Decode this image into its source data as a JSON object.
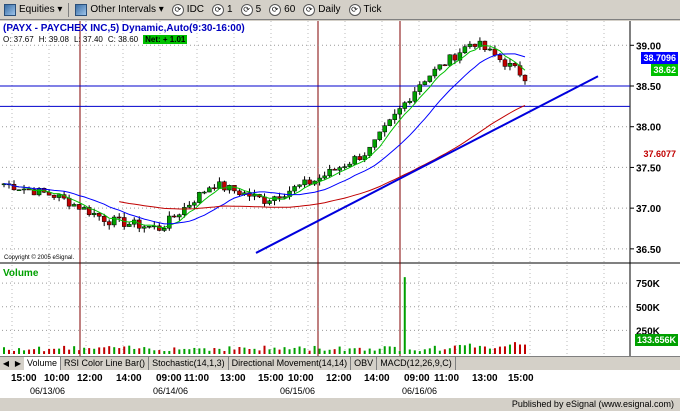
{
  "toolbar": {
    "equities": "Equities",
    "other_intervals": "Other Intervals",
    "idc": "IDC",
    "i1": "1",
    "i5": "5",
    "i60": "60",
    "daily": "Daily",
    "tick": "Tick"
  },
  "header": {
    "title": "(PAYX - PAYCHEX INC,5) Dynamic,Auto(9:30-16:00)",
    "open": "O: 37.67",
    "high": "H: 39.08",
    "low": "L: 37.40",
    "close": "C: 38.60",
    "net": "Net: + 1.01",
    "copyright": "Copyright © 2005 eSignal.",
    "volume_label": "Volume"
  },
  "axis": {
    "prices": [
      "39.00",
      "38.50",
      "38.00",
      "37.50",
      "37.00",
      "36.50"
    ],
    "volume": [
      "750K",
      "500K",
      "250K"
    ],
    "tag_last": "38.7096",
    "tag_close": "38.62",
    "tag_ma": "37.6077",
    "tag_vol": "133.656K"
  },
  "colors": {
    "candle_up": "#00a000",
    "candle_down": "#c00000",
    "ma_fast": "#00c000",
    "ma_mid": "#0000ff",
    "ma_slow": "#c00000",
    "trend": "#0000dd",
    "hline": "#0000cc"
  },
  "tabs": [
    "Volume",
    "RSI Color Line Bar()",
    "Stochastic(14,1,3)",
    "Directional Movement(14,14)",
    "OBV",
    "MACD(12,26,9,C)"
  ],
  "time_axis": {
    "times": [
      "15:00",
      "10:00",
      "12:00",
      "14:00",
      "09:00",
      "11:00",
      "13:00",
      "15:00",
      "10:00",
      "12:00",
      "14:00",
      "09:00",
      "11:00",
      "13:00",
      "15:00"
    ],
    "dates": [
      "06/13/06",
      "06/14/06",
      "06/15/06",
      "06/16/06"
    ]
  },
  "footer": "Published by eSignal (www.esignal.com)",
  "chart_data": {
    "type": "line",
    "title": "(PAYX - PAYCHEX INC,5) Dynamic,Auto(9:30-16:00)",
    "ylim": [
      36.4,
      39.2
    ],
    "series": [
      {
        "name": "",
        "x": [
          "06/13 15:00",
          "06/14 10:00",
          "06/14 12:00",
          "06/14 14:00",
          "06/15 10:00",
          "06/15 12:00",
          "06/15 14:00",
          "06/16 09:00",
          "06/16 11:00",
          "06/16 13:00",
          "06/16 15:00"
        ],
        "values": [
          37.3,
          37.15,
          36.85,
          36.75,
          37.3,
          37.1,
          37.35,
          37.7,
          38.55,
          39.05,
          38.62
        ]
      }
    ],
    "horizontal_lines": [
      38.5,
      38.25
    ],
    "last_price": 38.62
  }
}
